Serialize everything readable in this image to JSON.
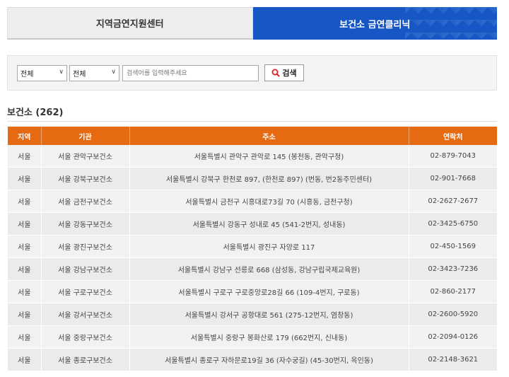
{
  "tabs": [
    {
      "label": "지역금연지원센터",
      "active": false
    },
    {
      "label": "보건소 금연클리닉",
      "active": true
    }
  ],
  "search": {
    "select1": "전체",
    "select2": "전체",
    "placeholder": "검색어를 입력해주세요",
    "button_label": "검색",
    "button_icon": "search-icon"
  },
  "section": {
    "title": "보건소 (262)"
  },
  "table": {
    "headers": [
      "지역",
      "기관",
      "주소",
      "연락처"
    ],
    "rows": [
      {
        "region": "서울",
        "org": "서울 관악구보건소",
        "addr": "서울특별시 관악구 관악로 145 (봉천동, 관악구청)",
        "tel": "02-879-7043"
      },
      {
        "region": "서울",
        "org": "서울 강북구보건소",
        "addr": "서울특별시 강북구 한천로 897, (한천로 897) (번동, 번2동주민센터)",
        "tel": "02-901-7668"
      },
      {
        "region": "서울",
        "org": "서울 금천구보건소",
        "addr": "서울특별시 금천구 시흥대로73길 70 (시흥동, 금천구청)",
        "tel": "02-2627-2677"
      },
      {
        "region": "서울",
        "org": "서울 강동구보건소",
        "addr": "서울특별시 강동구 성내로 45 (541-2번지, 성내동)",
        "tel": "02-3425-6750"
      },
      {
        "region": "서울",
        "org": "서울 광진구보건소",
        "addr": "서울특별시 광진구 자양로 117",
        "tel": "02-450-1569"
      },
      {
        "region": "서울",
        "org": "서울 강남구보건소",
        "addr": "서울특별시 강남구 선릉로 668 (삼성동, 강남구립국제교육원)",
        "tel": "02-3423-7236"
      },
      {
        "region": "서울",
        "org": "서울 구로구보건소",
        "addr": "서울특별시 구로구 구로중앙로28길 66 (109-4번지, 구로동)",
        "tel": "02-860-2177"
      },
      {
        "region": "서울",
        "org": "서울 강서구보건소",
        "addr": "서울특별시 강서구 공항대로 561 (275-12번지, 염창동)",
        "tel": "02-2600-5920"
      },
      {
        "region": "서울",
        "org": "서울 중랑구보건소",
        "addr": "서울특별시 중랑구 봉화산로 179 (662번지, 신내동)",
        "tel": "02-2094-0126"
      },
      {
        "region": "서울",
        "org": "서울 종로구보건소",
        "addr": "서울특별시 종로구 자하문로19길 36 (자수궁길) (45-30번지, 옥인동)",
        "tel": "02-2148-3621"
      }
    ]
  },
  "colors": {
    "tab_active": "#1656c5",
    "table_header": "#e66a12",
    "search_icon": "#e02020"
  }
}
